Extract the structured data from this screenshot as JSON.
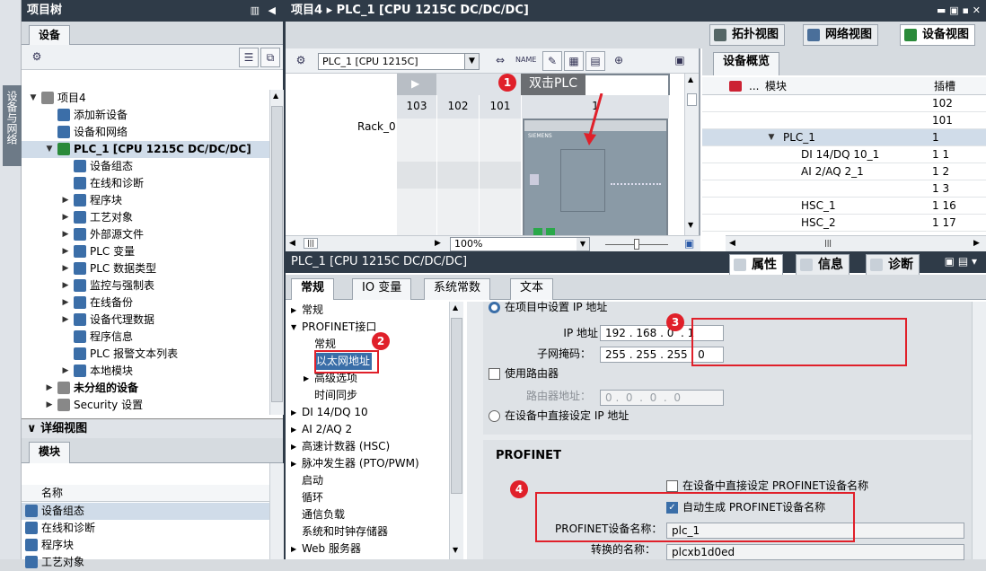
{
  "side_strip": {
    "label": "设备与网络"
  },
  "tree": {
    "title": "项目树",
    "tab": "设备",
    "items": [
      {
        "label": "项目4",
        "indent": 0,
        "arrow": "▼",
        "icon": "#888"
      },
      {
        "label": "添加新设备",
        "indent": 1,
        "arrow": "",
        "icon": "#3b6ea8"
      },
      {
        "label": "设备和网络",
        "indent": 1,
        "arrow": "",
        "icon": "#3b6ea8"
      },
      {
        "label": "PLC_1 [CPU 1215C DC/DC/DC]",
        "indent": 1,
        "arrow": "▼",
        "icon": "#2a8a3a",
        "bold": true
      },
      {
        "label": "设备组态",
        "indent": 2,
        "arrow": "",
        "icon": "#3b6ea8"
      },
      {
        "label": "在线和诊断",
        "indent": 2,
        "arrow": "",
        "icon": "#3b6ea8"
      },
      {
        "label": "程序块",
        "indent": 2,
        "arrow": "▶",
        "icon": "#3b6ea8"
      },
      {
        "label": "工艺对象",
        "indent": 2,
        "arrow": "▶",
        "icon": "#3b6ea8"
      },
      {
        "label": "外部源文件",
        "indent": 2,
        "arrow": "▶",
        "icon": "#3b6ea8"
      },
      {
        "label": "PLC 变量",
        "indent": 2,
        "arrow": "▶",
        "icon": "#3b6ea8"
      },
      {
        "label": "PLC 数据类型",
        "indent": 2,
        "arrow": "▶",
        "icon": "#3b6ea8"
      },
      {
        "label": "监控与强制表",
        "indent": 2,
        "arrow": "▶",
        "icon": "#3b6ea8"
      },
      {
        "label": "在线备份",
        "indent": 2,
        "arrow": "▶",
        "icon": "#3b6ea8"
      },
      {
        "label": "设备代理数据",
        "indent": 2,
        "arrow": "▶",
        "icon": "#3b6ea8"
      },
      {
        "label": "程序信息",
        "indent": 2,
        "arrow": "",
        "icon": "#3b6ea8"
      },
      {
        "label": "PLC 报警文本列表",
        "indent": 2,
        "arrow": "",
        "icon": "#3b6ea8"
      },
      {
        "label": "本地模块",
        "indent": 2,
        "arrow": "▶",
        "icon": "#3b6ea8"
      },
      {
        "label": "未分组的设备",
        "indent": 1,
        "arrow": "▶",
        "icon": "#888",
        "bold": true
      },
      {
        "label": "Security 设置",
        "indent": 1,
        "arrow": "▶",
        "icon": "#888"
      }
    ]
  },
  "details": {
    "title": "详细视图",
    "tab": "模块",
    "col_name": "名称",
    "items": [
      "设备组态",
      "在线和诊断",
      "程序块",
      "工艺对象"
    ]
  },
  "main": {
    "title": "项目4 ▸ PLC_1 [CPU 1215C DC/DC/DC]",
    "views": [
      "拓扑视图",
      "网络视图",
      "设备视图"
    ],
    "device_select": "PLC_1 [CPU 1215C]",
    "callout": "双击PLC",
    "slots": [
      "103",
      "102",
      "101",
      "1"
    ],
    "rack": "Rack_0",
    "zoom": "100%",
    "overview": {
      "tab": "设备概览",
      "col_module": "模块",
      "col_slot": "插槽",
      "rows": [
        [
          "",
          "102"
        ],
        [
          "",
          "101"
        ],
        [
          "PLC_1",
          "1"
        ],
        [
          "DI 14/DQ 10_1",
          "1 1"
        ],
        [
          "AI 2/AQ 2_1",
          "1 2"
        ],
        [
          "",
          "1 3"
        ],
        [
          "HSC_1",
          "1 16"
        ],
        [
          "HSC_2",
          "1 17"
        ]
      ]
    }
  },
  "props": {
    "title": "PLC_1 [CPU 1215C DC/DC/DC]",
    "top_tabs": [
      "属性",
      "信息",
      "诊断"
    ],
    "tabs": [
      "常规",
      "IO 变量",
      "系统常数",
      "文本"
    ],
    "nav": [
      {
        "label": "常规",
        "indent": 0,
        "arrow": "▶"
      },
      {
        "label": "PROFINET接口",
        "indent": 0,
        "arrow": "▼"
      },
      {
        "label": "常规",
        "indent": 1,
        "arrow": ""
      },
      {
        "label": "以太网地址",
        "indent": 1,
        "arrow": "",
        "sel": true
      },
      {
        "label": "高级选项",
        "indent": 1,
        "arrow": "▶"
      },
      {
        "label": "时间同步",
        "indent": 1,
        "arrow": ""
      },
      {
        "label": "DI 14/DQ 10",
        "indent": 0,
        "arrow": "▶"
      },
      {
        "label": "AI 2/AQ 2",
        "indent": 0,
        "arrow": "▶"
      },
      {
        "label": "高速计数器 (HSC)",
        "indent": 0,
        "arrow": "▶"
      },
      {
        "label": "脉冲发生器 (PTO/PWM)",
        "indent": 0,
        "arrow": "▶"
      },
      {
        "label": "启动",
        "indent": 0,
        "arrow": ""
      },
      {
        "label": "循环",
        "indent": 0,
        "arrow": ""
      },
      {
        "label": "通信负载",
        "indent": 0,
        "arrow": ""
      },
      {
        "label": "系统和时钟存储器",
        "indent": 0,
        "arrow": ""
      },
      {
        "label": "Web 服务器",
        "indent": 0,
        "arrow": "▶"
      }
    ],
    "ip_radio": "在项目中设置 IP 地址",
    "ip_label": "IP 地址：",
    "ip": [
      "192",
      "168",
      "0",
      "1"
    ],
    "mask_label": "子网掩码：",
    "mask": [
      "255",
      "255",
      "255",
      "0"
    ],
    "router_chk": "使用路由器",
    "router_label": "路由器地址：",
    "router": [
      "0",
      "0",
      "0",
      "0"
    ],
    "direct_radio": "在设备中直接设定 IP 地址",
    "profinet_header": "PROFINET",
    "pn_direct": "在设备中直接设定 PROFINET设备名称",
    "pn_auto": "自动生成 PROFINET设备名称",
    "pn_name_label": "PROFINET设备名称：",
    "pn_name": "plc_1",
    "conv_label": "转换的名称：",
    "conv": "plcxb1d0ed"
  },
  "badges": [
    "1",
    "2",
    "3",
    "4"
  ],
  "colors": {
    "dark": "#2f3b48",
    "red": "#e0202a",
    "sel": "#d0dce9"
  }
}
